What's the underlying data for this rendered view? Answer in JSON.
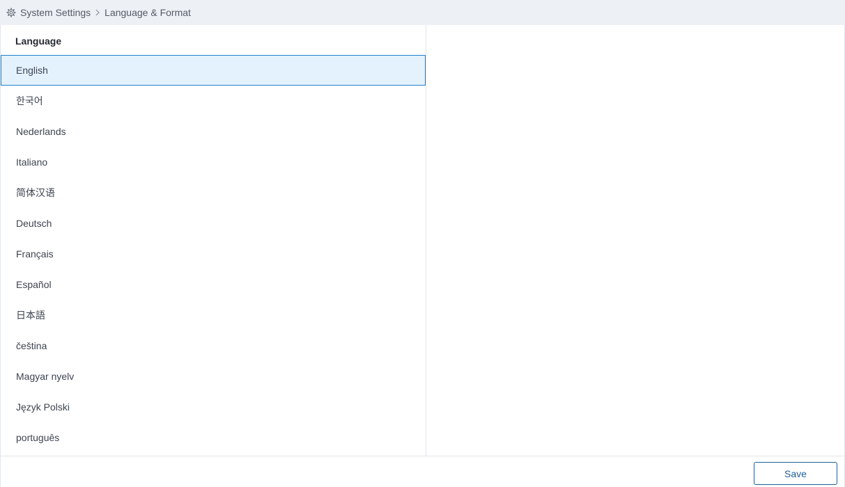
{
  "breadcrumb": {
    "icon": "gear-icon",
    "items": [
      "System Settings",
      "Language & Format"
    ],
    "separator_icon": "chevron-right-icon"
  },
  "language_panel": {
    "heading": "Language",
    "selected": "English",
    "options": [
      "English",
      "한국어",
      "Nederlands",
      "Italiano",
      "简体汉语",
      "Deutsch",
      "Français",
      "Español",
      "日本語",
      "čeština",
      "Magyar nyelv",
      "Język Polski",
      "português"
    ]
  },
  "footer": {
    "save_label": "Save"
  },
  "colors": {
    "selected_bg": "#e3f2fd",
    "selected_border": "#1f7fcf",
    "accent": "#1d5f9b",
    "breadcrumb_bg": "#edf0f4"
  }
}
